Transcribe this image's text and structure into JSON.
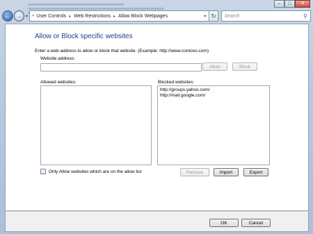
{
  "window": {
    "caption_buttons": {
      "minimize_icon": "minimize-icon",
      "maximize_icon": "maximize-icon",
      "close_icon": "close-icon"
    }
  },
  "nav": {
    "back_icon": "back-arrow-icon",
    "forward_icon": "forward-arrow-icon",
    "breadcrumbs": [
      "User Controls",
      "Web Restrictions",
      "Allow Block Webpages"
    ],
    "search_placeholder": "Search"
  },
  "page": {
    "title": "Allow or Block specific websites",
    "instruction": "Enter a web address to allow or block that website.  (Example: http://www.contoso.com)",
    "website_address_label": "Website address:",
    "website_address_value": "",
    "allow_button": "Allow",
    "block_button": "Block",
    "allowed_label": "Allowed websites:",
    "blocked_label": "Blocked websites:",
    "allowed_sites": [],
    "blocked_sites": [
      "http://groups.yahoo.com/",
      "http://mail.google.com/"
    ],
    "only_allow_checkbox": "Only Allow websites which are on the allow list",
    "only_allow_checked": false,
    "remove_button": "Remove",
    "import_button": "Import",
    "export_button": "Export"
  },
  "footer": {
    "ok_button": "OK",
    "cancel_button": "Cancel"
  }
}
